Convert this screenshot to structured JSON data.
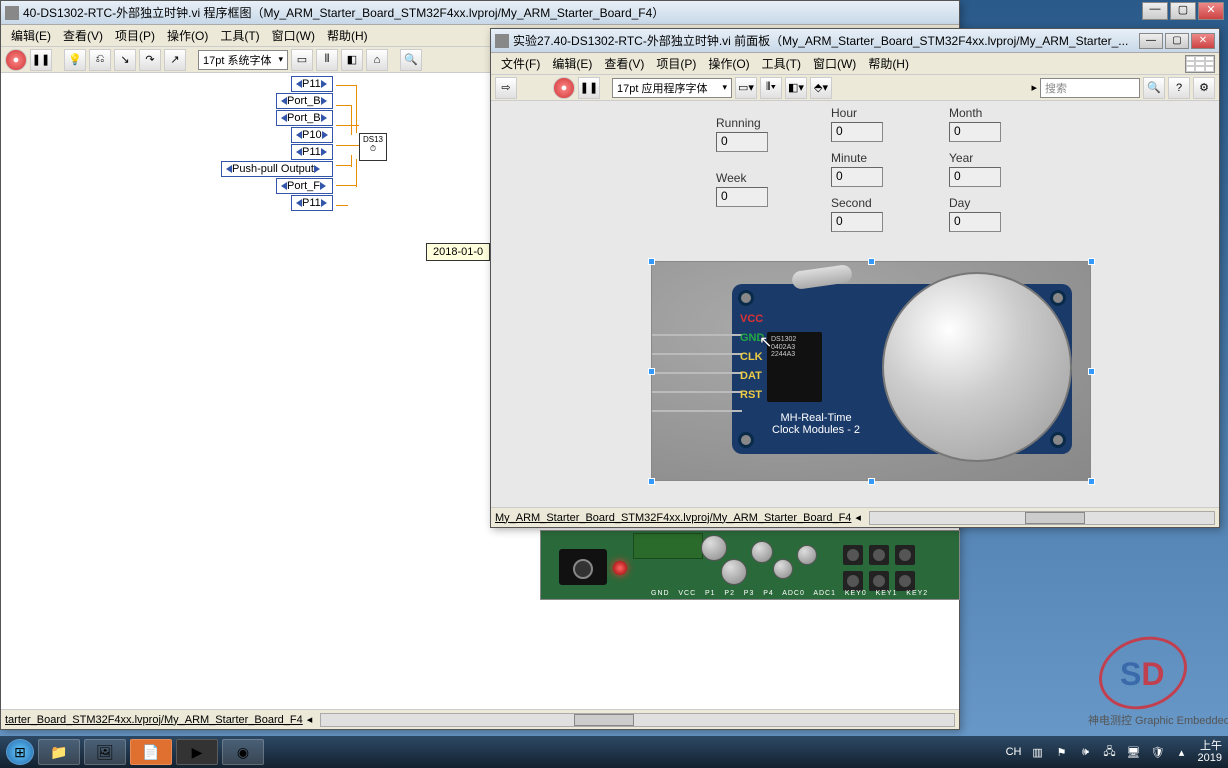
{
  "back_window": {
    "title": "40-DS1302-RTC-外部独立时钟.vi 程序框图（My_ARM_Starter_Board_STM32F4xx.lvproj/My_ARM_Starter_Board_F4）",
    "menu": [
      "编辑(E)",
      "查看(V)",
      "项目(P)",
      "操作(O)",
      "工具(T)",
      "窗口(W)",
      "帮助(H)"
    ],
    "font": "17pt 系统字体",
    "nodes": [
      "P11",
      "Port_B",
      "Port_B",
      "P10",
      "P11",
      "Push-pull Output",
      "Port_F",
      "P11"
    ],
    "chip": "DS13",
    "tip": "2018-01-0",
    "status_path": "tarter_Board_STM32F4xx.lvproj/My_ARM_Starter_Board_F4"
  },
  "front_window": {
    "title": "实验27.40-DS1302-RTC-外部独立时钟.vi 前面板（My_ARM_Starter_Board_STM32F4xx.lvproj/My_ARM_Starter_...",
    "menu": [
      "文件(F)",
      "编辑(E)",
      "查看(V)",
      "项目(P)",
      "操作(O)",
      "工具(T)",
      "窗口(W)",
      "帮助(H)"
    ],
    "font": "17pt 应用程序字体",
    "search_placeholder": "搜索",
    "fields": {
      "running": {
        "label": "Running",
        "value": "0"
      },
      "week": {
        "label": "Week",
        "value": "0"
      },
      "hour": {
        "label": "Hour",
        "value": "0"
      },
      "minute": {
        "label": "Minute",
        "value": "0"
      },
      "second": {
        "label": "Second",
        "value": "0"
      },
      "month": {
        "label": "Month",
        "value": "0"
      },
      "year": {
        "label": "Year",
        "value": "0"
      },
      "day": {
        "label": "Day",
        "value": "0"
      }
    },
    "module": {
      "pins": [
        "VCC",
        "GND",
        "CLK",
        "DAT",
        "RST"
      ],
      "chip_lines": [
        "DS1302",
        "0402A3",
        "2244A3"
      ],
      "text": [
        "MH-Real-Time",
        "Clock Modules - 2"
      ]
    },
    "status_path": "My_ARM_Starter_Board_STM32F4xx.lvproj/My_ARM_Starter_Board_F4"
  },
  "taskbar": {
    "ime": "CH",
    "time_label": "上午",
    "year": "2019"
  },
  "logo": {
    "s": "S",
    "d": "D",
    "sub": "神电测控 Graphic Embedded"
  }
}
